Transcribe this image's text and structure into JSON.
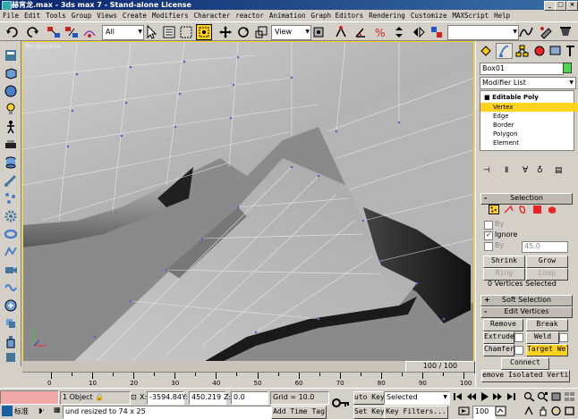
{
  "title": "赫宵龙.max - 3ds max 7 - Stand-alone License",
  "menu": [
    "File",
    "Edit",
    "Tools",
    "Group",
    "Views",
    "Create",
    "Modifiers",
    "Character",
    "reactor",
    "Animation",
    "Graph Editors",
    "Rendering",
    "Customize",
    "MAXScript",
    "Help"
  ],
  "toolbar": {
    "filter_value": "All",
    "coord_value": "View",
    "icons": [
      "undo-icon",
      "redo-icon",
      "select-link-icon",
      "unlink-icon",
      "bind-spacewarp-icon",
      "select-icon",
      "select-by-name-icon",
      "rect-region-icon",
      "window-crossing-icon",
      "move-icon",
      "rotate-icon",
      "scale-icon",
      "pivot-icon",
      "mirror-icon",
      "align-icon",
      "snap-icon",
      "angle-snap-icon",
      "percent-snap-icon",
      "spinner-snap-icon",
      "named-selection-icon",
      "curve-editor-icon",
      "render-icon",
      "quick-render-icon",
      "render-type-icon"
    ]
  },
  "viewport": {
    "label": "Perspective"
  },
  "time": {
    "slider": "100 / 100",
    "ticks": [
      "0",
      "10",
      "20",
      "30",
      "40",
      "50",
      "60",
      "70",
      "80",
      "90",
      "100"
    ]
  },
  "panel": {
    "object_name": "Box01",
    "object_color": "#4bd74b",
    "modifier_list": "Modifier List",
    "stack": {
      "title": "Editable Poly",
      "items": [
        "Vertex",
        "Edge",
        "Border",
        "Polygon",
        "Element"
      ]
    },
    "selection": {
      "header": "Selection",
      "by_vertex": "By",
      "ignore_backfacing": "Ignore",
      "by_angle": "By",
      "angle_value": "45.0",
      "shrink": "Shrink",
      "grow": "Grow",
      "ring": "Ring",
      "loop": "Loop",
      "status": "0 Vertices Selected"
    },
    "soft_selection": "Soft Selection",
    "edit_vertices": {
      "header": "Edit Vertices",
      "remove": "Remove",
      "break": "Break",
      "extrude": "Extrude",
      "weld": "Weld",
      "chamfer": "Chamfer",
      "target_weld": "Target Wel",
      "connect": "Connect",
      "remove_isolated": "emove Isolated Vertice"
    }
  },
  "status": {
    "lang": "标准",
    "objects": "1 Object",
    "x_label": "X:",
    "x_value": "-3594.84",
    "y_label": "Y:",
    "y_value": "450.219",
    "z_label": "Z:",
    "z_value": "0.0",
    "grid": "Grid = 10.0",
    "auto_key": "uto Key",
    "selected": "Selected",
    "set_key": "Set Key",
    "key_filters": "Key Filters...",
    "prompt": "und resized to 74 x 25",
    "add_time_tag": "Add Time Tag",
    "frame": "100"
  }
}
